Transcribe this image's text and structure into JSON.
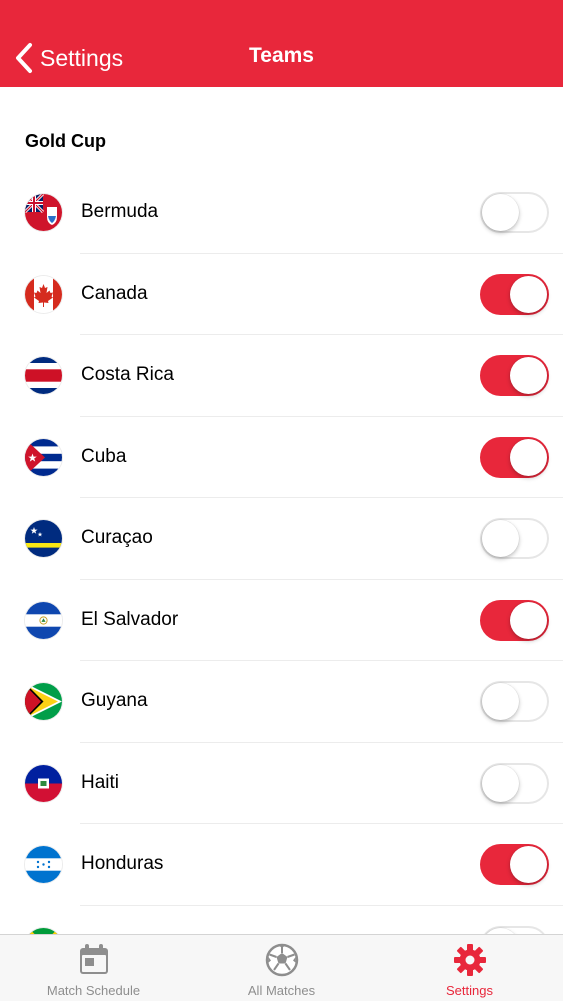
{
  "nav": {
    "back_label": "Settings",
    "title": "Teams"
  },
  "section": {
    "title": "Gold Cup"
  },
  "teams": [
    {
      "name": "Bermuda",
      "enabled": false
    },
    {
      "name": "Canada",
      "enabled": true
    },
    {
      "name": "Costa Rica",
      "enabled": true
    },
    {
      "name": "Cuba",
      "enabled": true
    },
    {
      "name": "Curaçao",
      "enabled": false
    },
    {
      "name": "El Salvador",
      "enabled": true
    },
    {
      "name": "Guyana",
      "enabled": false
    },
    {
      "name": "Haiti",
      "enabled": false
    },
    {
      "name": "Honduras",
      "enabled": true
    },
    {
      "name": "",
      "enabled": false
    }
  ],
  "tabs": [
    {
      "label": "Match Schedule",
      "icon": "calendar-icon",
      "active": false
    },
    {
      "label": "All Matches",
      "icon": "soccer-ball-icon",
      "active": false
    },
    {
      "label": "Settings",
      "icon": "gear-icon",
      "active": true
    }
  ],
  "colors": {
    "accent": "#e8273b",
    "toggle_off": "#ffffff",
    "tab_inactive": "#8e8e8e"
  }
}
